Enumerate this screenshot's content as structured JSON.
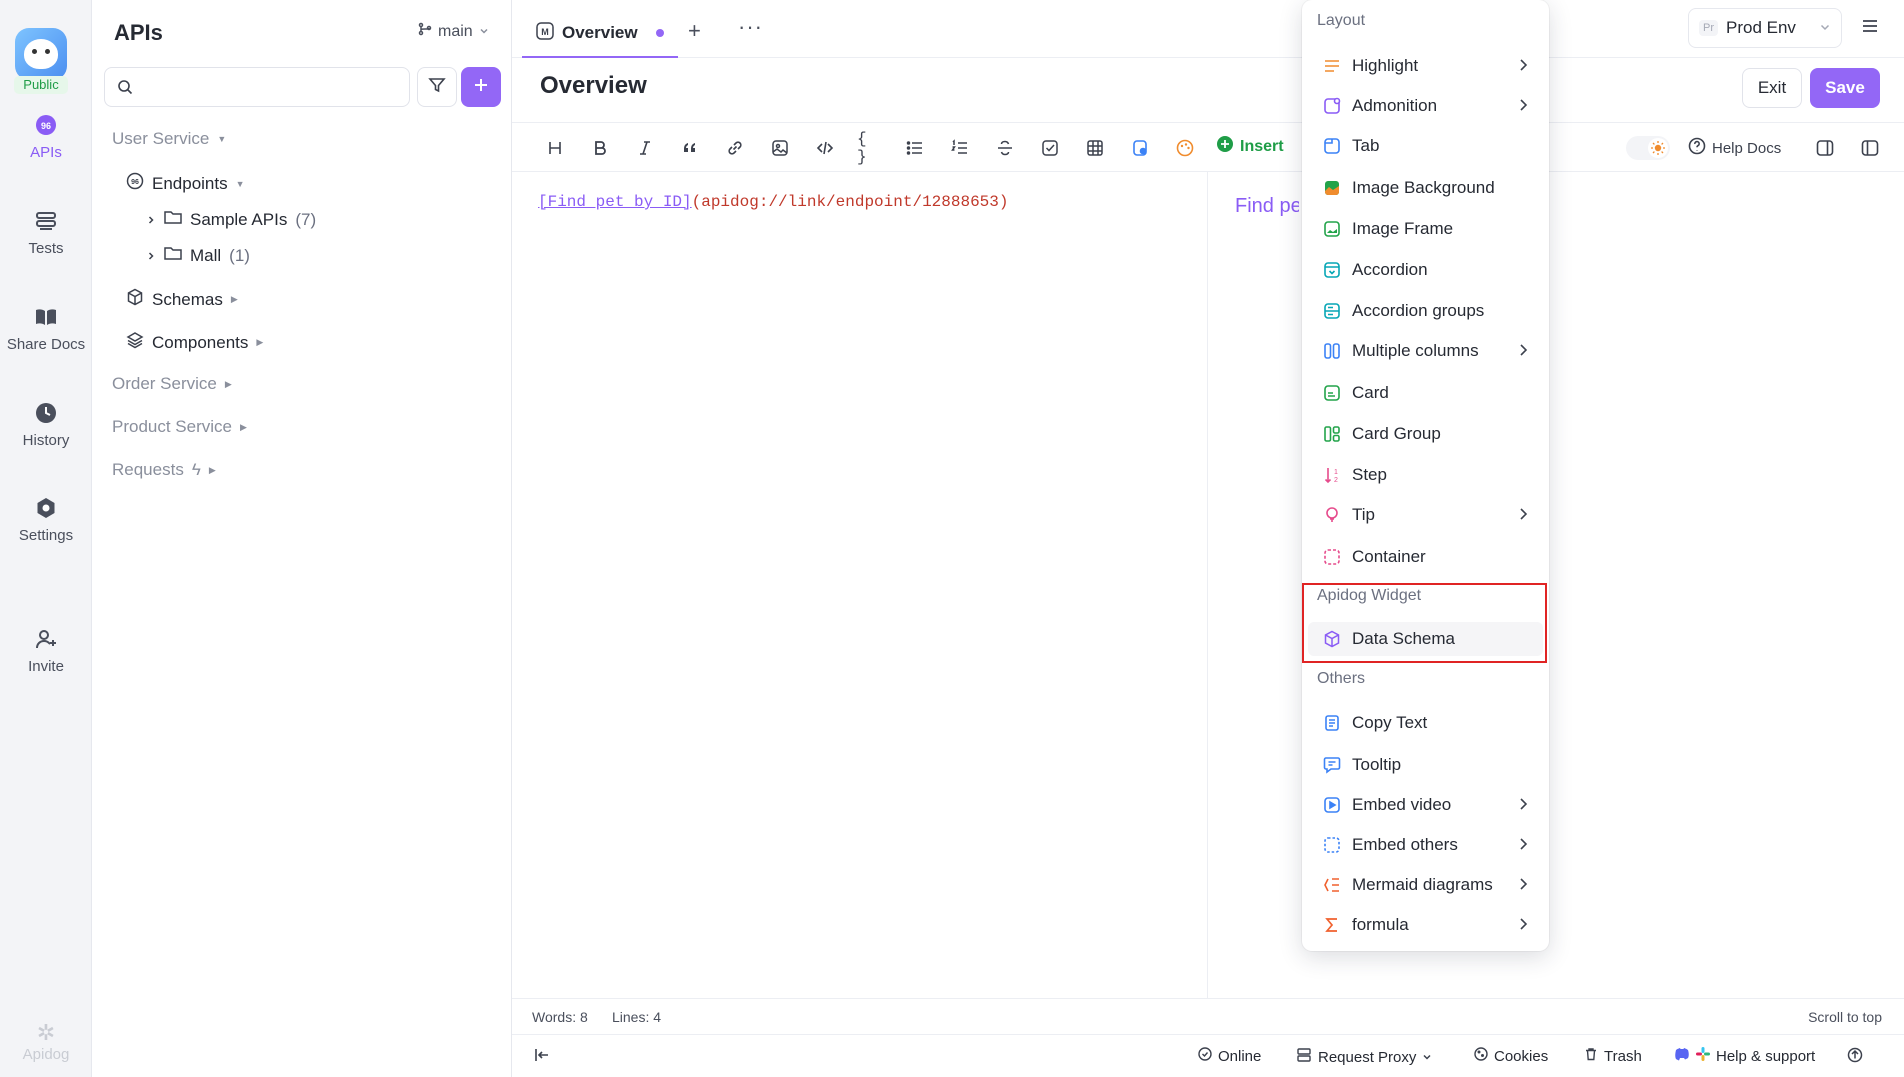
{
  "rail": {
    "badge": "Public",
    "items": [
      {
        "label": "APIs",
        "icon": "apis-icon"
      },
      {
        "label": "Tests",
        "icon": "tests-icon"
      },
      {
        "label": "Share Docs",
        "icon": "share-docs-icon"
      },
      {
        "label": "History",
        "icon": "history-icon"
      },
      {
        "label": "Settings",
        "icon": "settings-icon"
      },
      {
        "label": "Invite",
        "icon": "invite-icon"
      }
    ],
    "brand": "Apidog"
  },
  "sidebar": {
    "title": "APIs",
    "branch": "main",
    "search_placeholder": "",
    "tree": {
      "user_service": "User Service",
      "endpoints": "Endpoints",
      "sample_apis": "Sample APIs",
      "sample_apis_count": "(7)",
      "mall": "Mall",
      "mall_count": "(1)",
      "schemas": "Schemas",
      "components": "Components",
      "order_service": "Order Service",
      "product_service": "Product Service",
      "requests": "Requests"
    }
  },
  "tabs": {
    "active_label": "Overview"
  },
  "env": {
    "prefix": "Pr",
    "name": "Prod Env"
  },
  "doc": {
    "title": "Overview",
    "exit_label": "Exit",
    "save_label": "Save"
  },
  "toolbar": {
    "insert_label": "Insert",
    "help_docs_label": "Help Docs"
  },
  "editor": {
    "link_text": "[Find pet by ID]",
    "link_url": "(apidog://link/endpoint/12888653)",
    "preview_text": "Find pet by ID"
  },
  "status": {
    "words": "Words: 8",
    "lines": "Lines: 4",
    "scroll_top": "Scroll to top",
    "online": "Online",
    "request_proxy": "Request Proxy",
    "cookies": "Cookies",
    "trash": "Trash",
    "help_support": "Help & support"
  },
  "dropdown": {
    "sections": {
      "layout": "Layout",
      "apidog_widget": "Apidog Widget",
      "others": "Others"
    },
    "layout_items": [
      {
        "label": "Highlight",
        "submenu": true,
        "color": "#f08c2e"
      },
      {
        "label": "Admonition",
        "submenu": true,
        "color": "#8a5cf5"
      },
      {
        "label": "Tab",
        "submenu": false,
        "color": "#3b82f6"
      },
      {
        "label": "Image Background",
        "submenu": false,
        "color": "#22a34a"
      },
      {
        "label": "Image Frame",
        "submenu": false,
        "color": "#22a34a"
      },
      {
        "label": "Accordion",
        "submenu": false,
        "color": "#06a6b5"
      },
      {
        "label": "Accordion groups",
        "submenu": false,
        "color": "#06a6b5"
      },
      {
        "label": "Multiple columns",
        "submenu": true,
        "color": "#3b82f6"
      },
      {
        "label": "Card",
        "submenu": false,
        "color": "#22a34a"
      },
      {
        "label": "Card Group",
        "submenu": false,
        "color": "#22a34a"
      },
      {
        "label": "Step",
        "submenu": false,
        "color": "#e64b8c"
      },
      {
        "label": "Tip",
        "submenu": true,
        "color": "#e64b8c"
      },
      {
        "label": "Container",
        "submenu": false,
        "color": "#e64b8c"
      }
    ],
    "widget_items": [
      {
        "label": "Data Schema",
        "submenu": false,
        "color": "#8a5cf5"
      }
    ],
    "other_items": [
      {
        "label": "Copy Text",
        "submenu": false,
        "color": "#3b82f6"
      },
      {
        "label": "Tooltip",
        "submenu": false,
        "color": "#3b82f6"
      },
      {
        "label": "Embed video",
        "submenu": true,
        "color": "#3b82f6"
      },
      {
        "label": "Embed others",
        "submenu": true,
        "color": "#3b82f6"
      },
      {
        "label": "Mermaid diagrams",
        "submenu": true,
        "color": "#f0612e"
      },
      {
        "label": "formula",
        "submenu": true,
        "color": "#f0612e"
      }
    ]
  }
}
